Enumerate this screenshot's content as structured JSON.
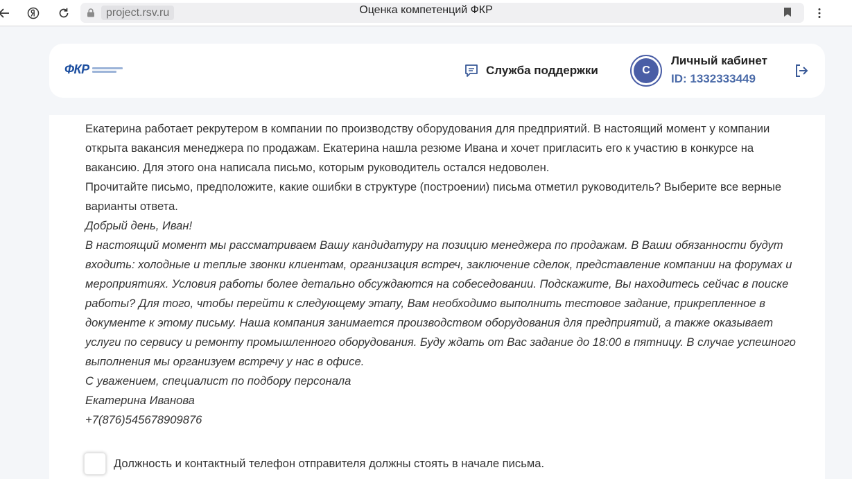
{
  "browser": {
    "url": "project.rsv.ru",
    "tab_title": "Оценка компетенций ФКР"
  },
  "header": {
    "logo_text": "ФКР",
    "support_label": "Служба поддержки",
    "avatar_letter": "С",
    "cabinet_title": "Личный кабинет",
    "cabinet_id": "ID: 1332333449"
  },
  "question": {
    "paragraphs": [
      {
        "text": "Екатерина работает рекрутером в компании по производству оборудования для предприятий. В настоящий момент у компании открыта вакансия менеджера по продажам. Екатерина нашла резюме Ивана и хочет пригласить его к участию в конкурсе на вакансию. Для этого она написала письмо, которым руководитель остался недоволен.",
        "italic": false
      },
      {
        "text": "Прочитайте письмо, предположите, какие ошибки в структуре (построении) письма отметил руководитель? Выберите все верные варианты ответа.",
        "italic": false
      },
      {
        "text": "Добрый день, Иван!",
        "italic": true
      },
      {
        "text": "В настоящий момент мы рассматриваем Вашу кандидатуру на позицию менеджера по продажам. В Ваши обязанности будут входить: холодные и теплые звонки клиентам, организация встреч, заключение сделок, представление компании на форумах и мероприятиях. Условия работы более детально обсуждаются на собеседовании. Подскажите, Вы находитесь сейчас в поиске работы? Для того, чтобы перейти к следующему этапу, Вам необходимо выполнить тестовое задание, прикрепленное в документе к этому письму. Наша компания занимается производством оборудования для предприятий, а также оказывает услуги по сервису и ремонту промышленного оборудования. Буду ждать от Вас задание до 18:00 в пятницу. В случае успешного выполнения мы организуем встречу у нас в офисе.",
        "italic": true
      },
      {
        "text": "С уважением, специалист по подбору персонала",
        "italic": true
      },
      {
        "text": "Екатерина Иванова",
        "italic": true
      },
      {
        "text": "+7(876)545678909876",
        "italic": true
      }
    ],
    "options": [
      {
        "label": "Должность и контактный телефон отправителя должны стоять в начале письма.",
        "checked": false
      }
    ]
  }
}
